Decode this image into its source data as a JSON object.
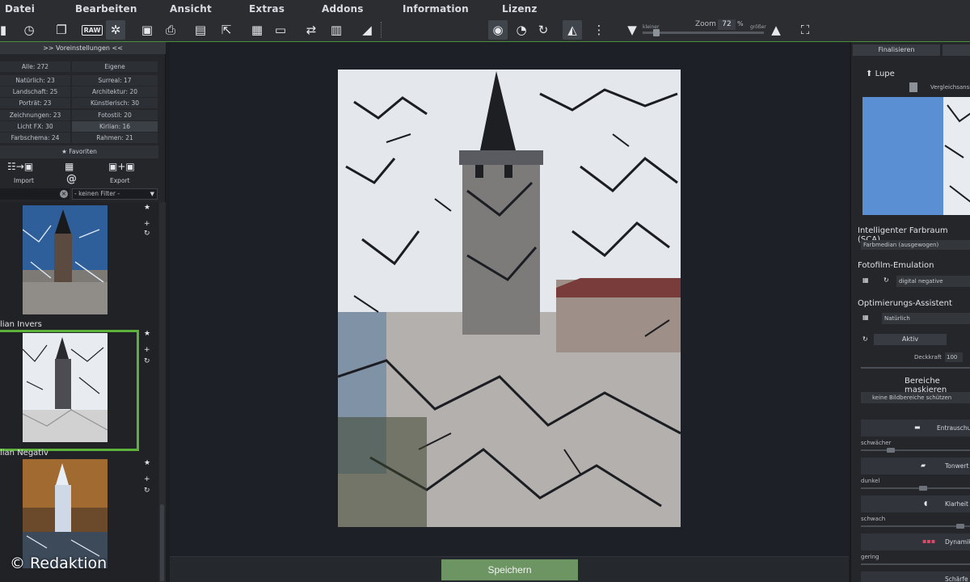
{
  "menu": [
    "Datei",
    "Bearbeiten",
    "Ansicht",
    "Extras",
    "Addons",
    "Information",
    "Lizenz"
  ],
  "toolbar": {
    "raw_label": "RAW",
    "zoom_label": "Zoom",
    "zoom_value": "72",
    "zoom_unit": "%",
    "zoom_smaller": "kleiner",
    "zoom_larger": "größer"
  },
  "left_panel": {
    "header": ">> Voreinstellungen <<",
    "categories": [
      {
        "label": "Alle: 272"
      },
      {
        "label": "Eigene"
      },
      {
        "label": "Natürlich: 23"
      },
      {
        "label": "Surreal: 17"
      },
      {
        "label": "Landschaft: 25"
      },
      {
        "label": "Architektur: 20"
      },
      {
        "label": "Porträt: 23"
      },
      {
        "label": "Künstlerisch: 30"
      },
      {
        "label": "Zeichnungen: 23"
      },
      {
        "label": "Fotostil: 20"
      },
      {
        "label": "Licht FX: 30"
      },
      {
        "label": "Kirlian: 16"
      },
      {
        "label": "Farbschema: 24"
      },
      {
        "label": "Rahmen: 21"
      }
    ],
    "favorites_label": "Favoriten",
    "import_label": "Import",
    "export_label": "Export",
    "at_symbol": "@",
    "filter_placeholder": "- keinen Filter -",
    "thumbnails": [
      {
        "name": ""
      },
      {
        "name": "lian Invers"
      },
      {
        "name": "lian Negativ"
      }
    ],
    "watermark": "© Redaktion"
  },
  "center": {
    "save_label": "Speichern"
  },
  "right_panel": {
    "finalize_label": "Finalisieren",
    "lupe_label": "Lupe",
    "compare_label": "Vergleichsansicht",
    "sca_title": "Intelligenter Farbraum (SCA)",
    "sca_value": "Farbmedian (ausgewogen)",
    "film_title": "Fotofilm-Emulation",
    "film_value": "digital negative",
    "assist_title": "Optimierungs-Assistent",
    "assist_value": "Natürlich",
    "active_label": "Aktiv",
    "opacity_label": "Deckkraft",
    "opacity_value": "100",
    "mask_title": "Bereiche maskieren",
    "mask_option": "keine Bildbereiche schützen",
    "sections": [
      {
        "label": "Entrauschung",
        "slider_left": "schwächer"
      },
      {
        "label": "Tonwert",
        "slider_left": "dunkel"
      },
      {
        "label": "Klarheit",
        "slider_left": "schwach"
      },
      {
        "label": "Dynamik",
        "slider_left": "gering"
      },
      {
        "label": "Schärfe",
        "slider_left": ""
      }
    ]
  }
}
